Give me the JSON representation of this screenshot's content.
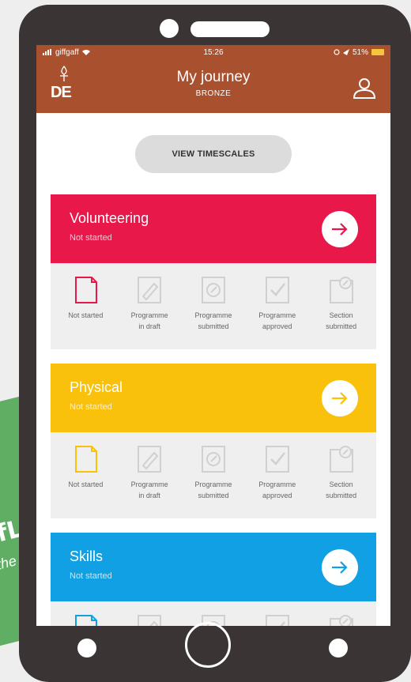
{
  "background_card": {
    "text": "fL",
    "sub": "the"
  },
  "status_bar": {
    "carrier": "giffgaff",
    "time": "15:26",
    "battery": "51%"
  },
  "header": {
    "logo_text": "DE",
    "title": "My journey",
    "subtitle": "BRONZE"
  },
  "timescales_button": "VIEW TIMESCALES",
  "steps": [
    {
      "label": "Not started",
      "icon": "document-icon"
    },
    {
      "label": "Programme\nin draft",
      "icon": "pencil-icon"
    },
    {
      "label": "Programme\nsubmitted",
      "icon": "submit-icon"
    },
    {
      "label": "Programme\napproved",
      "icon": "check-icon"
    },
    {
      "label": "Section\nsubmitted",
      "icon": "upload-icon"
    }
  ],
  "sections": [
    {
      "title": "Volunteering",
      "status": "Not started",
      "color": "#e8184a"
    },
    {
      "title": "Physical",
      "status": "Not started",
      "color": "#f9c10b"
    },
    {
      "title": "Skills",
      "status": "Not started",
      "color": "#10a0e3"
    }
  ],
  "colors": {
    "header": "#a9502f",
    "step_background": "#efefef"
  }
}
